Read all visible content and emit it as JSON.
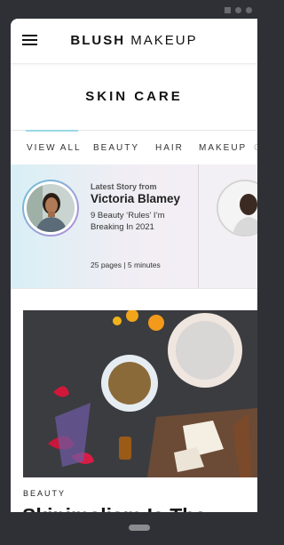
{
  "header": {
    "brand_bold": "BLUSH",
    "brand_light": "MAKEUP"
  },
  "page": {
    "title": "SKIN CARE"
  },
  "tabs": [
    {
      "label": "VIEW ALL",
      "active": true
    },
    {
      "label": "BEAUTY"
    },
    {
      "label": "HAIR"
    },
    {
      "label": "MAKEUP"
    }
  ],
  "stories": [
    {
      "kicker": "Latest Story from",
      "author": "Victoria Blamey",
      "title": "9 Beauty ‘Rules’ I’m Breaking In 2021",
      "meta": "25 pages | 5 minutes"
    }
  ],
  "article": {
    "kicker": "BEAUTY",
    "title": "Skinimalism Is The"
  },
  "colors": {
    "accent": "#9bd8e6",
    "ring_start": "#6cc4da",
    "ring_end": "#b58ad6",
    "text": "#111111"
  }
}
